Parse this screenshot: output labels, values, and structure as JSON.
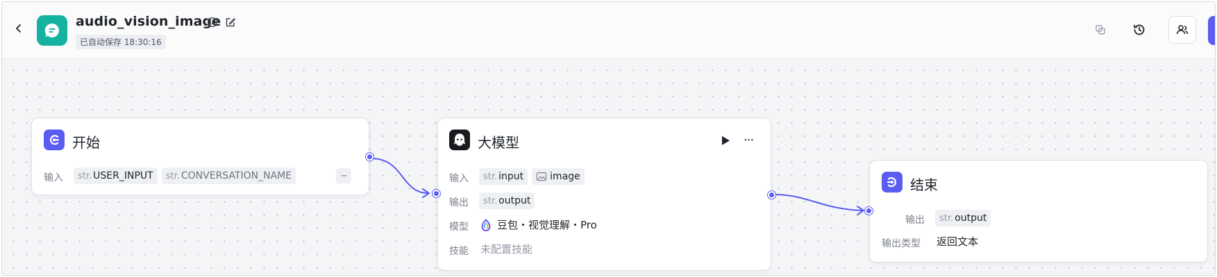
{
  "header": {
    "app_title": "audio_vision_image",
    "autosave_status": "已自动保存 18:30:16",
    "icons": {
      "back": "chevron-left-icon",
      "logo": "chat-bubble-icon",
      "info": "info-icon",
      "edit": "edit-icon",
      "copy": "copy-icon",
      "history": "history-icon",
      "collaborators": "users-icon"
    },
    "accent_color": "#5a5cf2",
    "logo_color": "#15b2a1"
  },
  "nodes": {
    "start": {
      "title": "开始",
      "input_label": "输入",
      "inputs": [
        {
          "type": "str.",
          "name": "USER_INPUT"
        },
        {
          "type": "str.",
          "name": "CONVERSATION_NAME"
        }
      ],
      "more": "···"
    },
    "llm": {
      "title": "大模型",
      "input_label": "输入",
      "inputs": [
        {
          "type": "str.",
          "name": "input"
        },
        {
          "type": "",
          "name": "image",
          "icon": "image-icon"
        }
      ],
      "output_label": "输出",
      "outputs": [
        {
          "type": "str.",
          "name": "output"
        }
      ],
      "model_label": "模型",
      "model_value": "豆包・视觉理解・Pro",
      "skills_label": "技能",
      "skills_value": "未配置技能",
      "run_icon": "play-icon",
      "more": "···"
    },
    "end": {
      "title": "结束",
      "output_label": "输出",
      "outputs": [
        {
          "type": "str.",
          "name": "output"
        }
      ],
      "output_type_label": "输出类型",
      "output_type_value": "返回文本"
    }
  }
}
